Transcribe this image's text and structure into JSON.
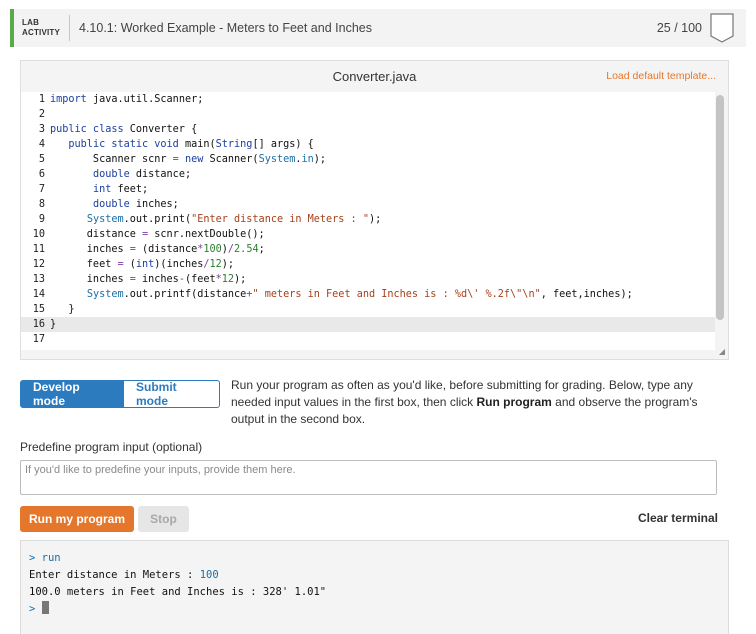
{
  "header": {
    "lab_line1": "LAB",
    "lab_line2": "ACTIVITY",
    "title": "4.10.1: Worked Example - Meters to Feet and Inches",
    "score": "25 / 100",
    "accent_color": "#5aaa4a"
  },
  "editor": {
    "file_name": "Converter.java",
    "load_template_label": "Load default template...",
    "active_line": 16,
    "lines": [
      {
        "n": "1",
        "tokens": [
          [
            "kw",
            "import"
          ],
          [
            "t",
            " java.util.Scanner;"
          ]
        ]
      },
      {
        "n": "2",
        "tokens": []
      },
      {
        "n": "3",
        "tokens": [
          [
            "kw",
            "public class"
          ],
          [
            "t",
            " Converter {"
          ]
        ]
      },
      {
        "n": "4",
        "tokens": [
          [
            "t",
            "   "
          ],
          [
            "kw",
            "public static void"
          ],
          [
            "t",
            " main("
          ],
          [
            "kw",
            "String"
          ],
          [
            "t",
            "[] args) {"
          ]
        ]
      },
      {
        "n": "5",
        "tokens": [
          [
            "t",
            "       Scanner scnr "
          ],
          [
            "op",
            "="
          ],
          [
            "t",
            " "
          ],
          [
            "kw",
            "new"
          ],
          [
            "t",
            " Scanner("
          ],
          [
            "sys",
            "System"
          ],
          [
            "t",
            "."
          ],
          [
            "sys",
            "in"
          ],
          [
            "t",
            ");"
          ]
        ]
      },
      {
        "n": "6",
        "tokens": [
          [
            "t",
            "       "
          ],
          [
            "kw",
            "double"
          ],
          [
            "t",
            " distance;"
          ]
        ]
      },
      {
        "n": "7",
        "tokens": [
          [
            "t",
            "       "
          ],
          [
            "kw",
            "int"
          ],
          [
            "t",
            " feet;"
          ]
        ]
      },
      {
        "n": "8",
        "tokens": [
          [
            "t",
            "       "
          ],
          [
            "kw",
            "double"
          ],
          [
            "t",
            " inches;"
          ]
        ]
      },
      {
        "n": "9",
        "tokens": [
          [
            "t",
            "      "
          ],
          [
            "sys",
            "System"
          ],
          [
            "t",
            ".out.print("
          ],
          [
            "str",
            "\"Enter distance in Meters : \""
          ],
          [
            "t",
            ");"
          ]
        ]
      },
      {
        "n": "10",
        "tokens": [
          [
            "t",
            "      distance "
          ],
          [
            "op",
            "="
          ],
          [
            "t",
            " scnr.nextDouble();"
          ]
        ]
      },
      {
        "n": "11",
        "tokens": [
          [
            "t",
            "      inches "
          ],
          [
            "op",
            "="
          ],
          [
            "t",
            " (distance"
          ],
          [
            "op",
            "*"
          ],
          [
            "num",
            "100"
          ],
          [
            "t",
            ")"
          ],
          [
            "op",
            "/"
          ],
          [
            "num",
            "2.54"
          ],
          [
            "t",
            ";"
          ]
        ]
      },
      {
        "n": "12",
        "tokens": [
          [
            "t",
            "      feet "
          ],
          [
            "op",
            "="
          ],
          [
            "t",
            " ("
          ],
          [
            "kw",
            "int"
          ],
          [
            "t",
            ")(inches"
          ],
          [
            "op",
            "/"
          ],
          [
            "num",
            "12"
          ],
          [
            "t",
            ");"
          ]
        ]
      },
      {
        "n": "13",
        "tokens": [
          [
            "t",
            "      inches "
          ],
          [
            "op",
            "="
          ],
          [
            "t",
            " inches"
          ],
          [
            "op",
            "-"
          ],
          [
            "t",
            "(feet"
          ],
          [
            "op",
            "*"
          ],
          [
            "num",
            "12"
          ],
          [
            "t",
            ");"
          ]
        ]
      },
      {
        "n": "14",
        "tokens": [
          [
            "t",
            "      "
          ],
          [
            "sys",
            "System"
          ],
          [
            "t",
            ".out.printf(distance"
          ],
          [
            "op",
            "+"
          ],
          [
            "str",
            "\" meters in Feet and Inches is : %d\\' %.2f\\\"\\n\""
          ],
          [
            "t",
            ", feet,inches);"
          ]
        ]
      },
      {
        "n": "15",
        "tokens": [
          [
            "t",
            "   }"
          ]
        ]
      },
      {
        "n": "16",
        "tokens": [
          [
            "t",
            "}"
          ]
        ]
      },
      {
        "n": "17",
        "tokens": []
      }
    ]
  },
  "modes": {
    "develop_label": "Develop mode",
    "submit_label": "Submit mode",
    "instructions_part1": "Run your program as often as you'd like, before submitting for grading. Below, type any needed input values in the first box, then click ",
    "instructions_bold": "Run program",
    "instructions_part2": " and observe the program's output in the second box."
  },
  "input": {
    "label": "Predefine program input (optional)",
    "placeholder": "If you'd like to predefine your inputs, provide them here.",
    "value": ""
  },
  "actions": {
    "run_label": "Run my program",
    "stop_label": "Stop",
    "clear_label": "Clear terminal",
    "run_color": "#e5772c"
  },
  "terminal": {
    "prompt": ">",
    "command": "run",
    "line2_text": "Enter distance in Meters : ",
    "line2_input": "100",
    "line3_text": "100.0 meters in Feet and Inches is : 328' 1.01\""
  }
}
